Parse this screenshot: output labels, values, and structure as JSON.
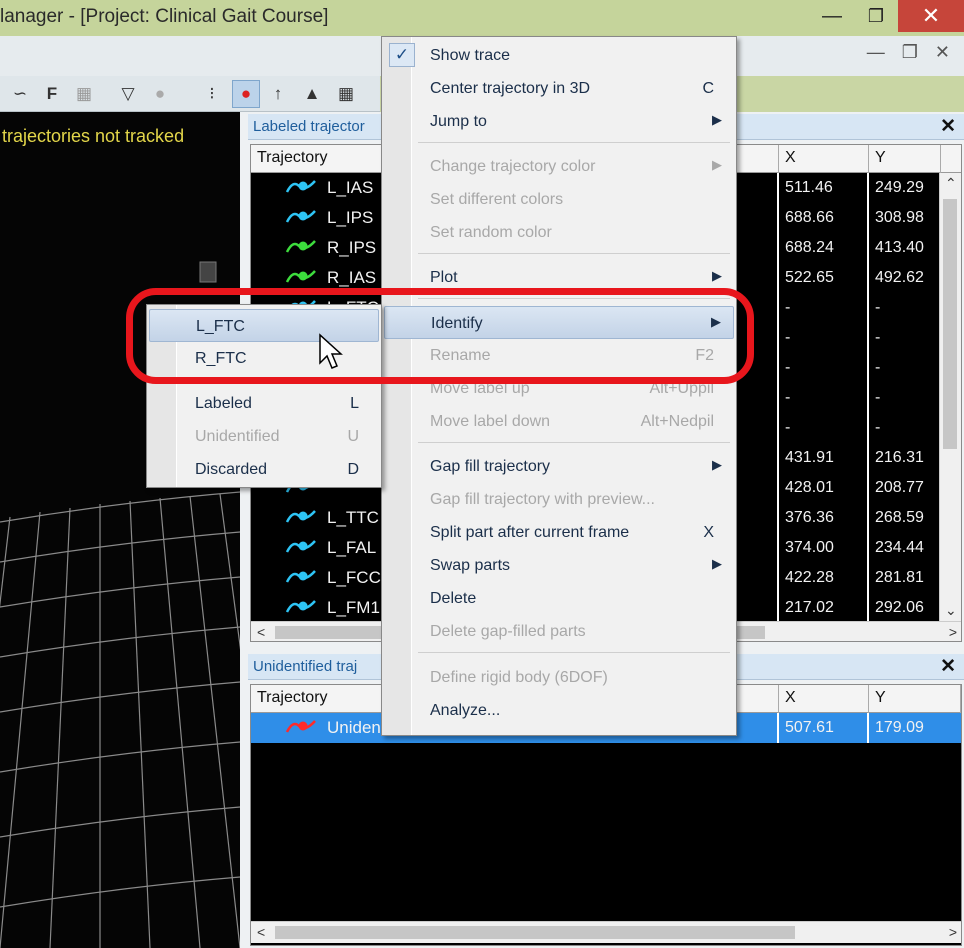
{
  "window": {
    "title": "lanager - [Project: Clinical Gait Course]",
    "min_icon": "minimize-icon",
    "max_icon": "maximize-icon",
    "close_icon": "close-icon"
  },
  "view3d": {
    "warning": "trajectories not tracked"
  },
  "labeled_panel": {
    "title": "Labeled trajector",
    "columns": [
      "Trajectory",
      "X",
      "Y"
    ],
    "rows": [
      {
        "name": "L_IAS",
        "color": "#2ec4f4",
        "x": "511.46",
        "y": "249.29"
      },
      {
        "name": "L_IPS",
        "color": "#2ec4f4",
        "x": "688.66",
        "y": "308.98"
      },
      {
        "name": "R_IPS",
        "color": "#3ddc3d",
        "x": "688.24",
        "y": "413.40"
      },
      {
        "name": "R_IAS",
        "color": "#3ddc3d",
        "x": "522.65",
        "y": "492.62"
      },
      {
        "name": "L_FTC",
        "color": "#2ec4f4",
        "x": "-",
        "y": "-"
      },
      {
        "name": "",
        "color": "#2ec4f4",
        "x": "-",
        "y": "-"
      },
      {
        "name": "",
        "color": "#2ec4f4",
        "x": "-",
        "y": "-"
      },
      {
        "name": "",
        "color": "#2ec4f4",
        "x": "-",
        "y": "-"
      },
      {
        "name": "",
        "color": "#2ec4f4",
        "x": "-",
        "y": "-"
      },
      {
        "name": "",
        "color": "#2ec4f4",
        "x": "431.91",
        "y": "216.31"
      },
      {
        "name": "",
        "color": "#2ec4f4",
        "x": "428.01",
        "y": "208.77"
      },
      {
        "name": "L_TTC",
        "color": "#2ec4f4",
        "x": "376.36",
        "y": "268.59"
      },
      {
        "name": "L_FAL",
        "color": "#2ec4f4",
        "x": "374.00",
        "y": "234.44"
      },
      {
        "name": "L_FCC",
        "color": "#2ec4f4",
        "x": "422.28",
        "y": "281.81"
      },
      {
        "name": "L_FM1",
        "color": "#2ec4f4",
        "x": "217.02",
        "y": "292.06"
      }
    ]
  },
  "unidentified_panel": {
    "title": "Unidentified traj",
    "columns": [
      "Trajectory",
      "X",
      "Y"
    ],
    "rows": [
      {
        "name": "Uniden",
        "color": "#ff2a2a",
        "x": "507.61",
        "y": "179.09"
      }
    ]
  },
  "context_menu": {
    "items": [
      {
        "label": "Show trace",
        "shortcut": "",
        "checked": true
      },
      {
        "label": "Center trajectory in 3D",
        "shortcut": "C"
      },
      {
        "label": "Jump to",
        "submenu": true
      },
      {
        "label": "Change trajectory color",
        "submenu": true,
        "disabled": true
      },
      {
        "label": "Set different colors",
        "disabled": true
      },
      {
        "label": "Set random color",
        "disabled": true
      },
      {
        "label": "Plot",
        "submenu": true
      },
      {
        "label": "Identify",
        "submenu": true,
        "highlighted": true
      },
      {
        "label": "Rename",
        "shortcut": "F2",
        "disabled": true
      },
      {
        "label": "Move label up",
        "shortcut": "Alt+Uppil",
        "disabled": true
      },
      {
        "label": "Move label down",
        "shortcut": "Alt+Nedpil",
        "disabled": true
      },
      {
        "label": "Gap fill trajectory",
        "submenu": true
      },
      {
        "label": "Gap fill trajectory with preview...",
        "disabled": true
      },
      {
        "label": "Split part after current frame",
        "shortcut": "X"
      },
      {
        "label": "Swap parts",
        "submenu": true
      },
      {
        "label": "Delete"
      },
      {
        "label": "Delete gap-filled parts",
        "disabled": true
      },
      {
        "label": "Define rigid body (6DOF)",
        "disabled": true
      },
      {
        "label": "Analyze..."
      }
    ]
  },
  "identify_submenu": {
    "items": [
      {
        "label": "L_FTC",
        "highlighted": true
      },
      {
        "label": "R_FTC"
      },
      {
        "label": "Labeled",
        "shortcut": "L"
      },
      {
        "label": "Unidentified",
        "shortcut": "U",
        "disabled": true
      },
      {
        "label": "Discarded",
        "shortcut": "D"
      }
    ]
  },
  "annotation": {
    "color": "#e8161c"
  }
}
